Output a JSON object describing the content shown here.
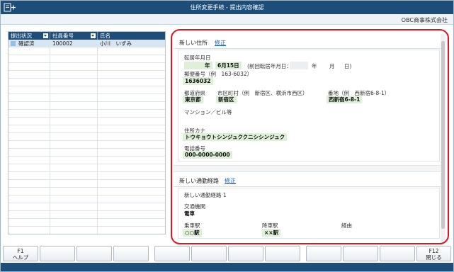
{
  "window": {
    "title": "住所変更手続 - 提出内容確認",
    "company": "OBC商事株式会社"
  },
  "grid": {
    "headers": [
      "提出状況",
      "社員番号",
      "氏名"
    ],
    "rows": [
      {
        "status": "確認済",
        "employee_no": "100002",
        "name": "小川　いずみ"
      }
    ]
  },
  "address": {
    "section_title": "新しい住所",
    "edit_label": "修正",
    "move_date_label": "転居年月日",
    "move_date_year_unit": "年",
    "move_date_value": "6月15日",
    "prev_move_label": "(前回転居年月日：",
    "prev_year_unit": "年",
    "prev_month_unit": "月",
    "prev_day_unit": "日)",
    "postal_label": "郵便番号（例　163-6032）",
    "postal_value": "1636032",
    "pref_label": "都道府県",
    "pref_value": "東京都",
    "city_label": "市区町村（例　新宿区、横浜市西区）",
    "city_value": "新宿区",
    "street_label": "番地（例　西新宿6-8-1）",
    "street_value": "西新宿6-8-1",
    "building_label": "マンション／ビル等",
    "kana_label": "住所カナ",
    "kana_value": "トウキョウトシンジュククニシシンジュク",
    "phone_label": "電話番号",
    "phone_value": "000-0000-0000"
  },
  "commute": {
    "section_title": "新しい通勤経路",
    "edit_label": "修正",
    "route_title": "新しい通勤経路 1",
    "transport_label": "交通機関",
    "transport_value": "電車",
    "board_label": "乗車駅",
    "board_value": "○○駅",
    "alight_label": "降車駅",
    "alight_value": "××駅",
    "via_label": "経由"
  },
  "footer": {
    "f1_key": "F1",
    "f1_label": "ヘルプ",
    "f12_key": "F12",
    "f12_label": "閉じる"
  },
  "colors": {
    "titlebar": "#1d4e79",
    "highlight_outline": "#e0141e",
    "value_bg": "#dff0d8",
    "link": "#1a5fb4"
  }
}
